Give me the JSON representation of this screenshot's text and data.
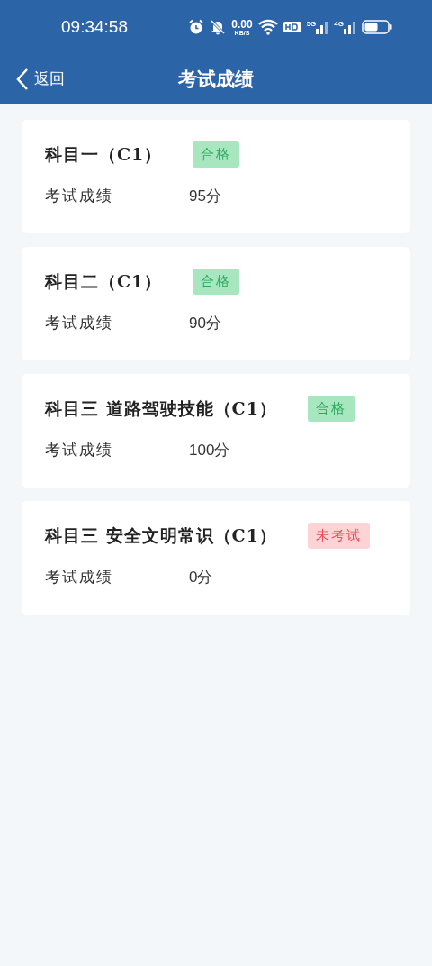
{
  "status_bar": {
    "time": "09:34:58",
    "net_speed": "0.00",
    "net_unit": "KB/S",
    "sim_1": "5G",
    "sim_2": "4G"
  },
  "header": {
    "back": "返回",
    "title": "考试成绩"
  },
  "results": [
    {
      "subject": "科目一（C1）",
      "status": {
        "kind": "passed",
        "label": "合格"
      },
      "score_label": "考试成绩",
      "score": "95分"
    },
    {
      "subject": "科目二（C1）",
      "status": {
        "kind": "passed",
        "label": "合格"
      },
      "score_label": "考试成绩",
      "score": "90分"
    },
    {
      "subject": "科目三 道路驾驶技能（C1）",
      "status": {
        "kind": "passed",
        "label": "合格"
      },
      "score_label": "考试成绩",
      "score": "100分"
    },
    {
      "subject": "科目三 安全文明常识（C1）",
      "status": {
        "kind": "not_taken",
        "label": "未考试"
      },
      "score_label": "考试成绩",
      "score": "0分"
    }
  ]
}
